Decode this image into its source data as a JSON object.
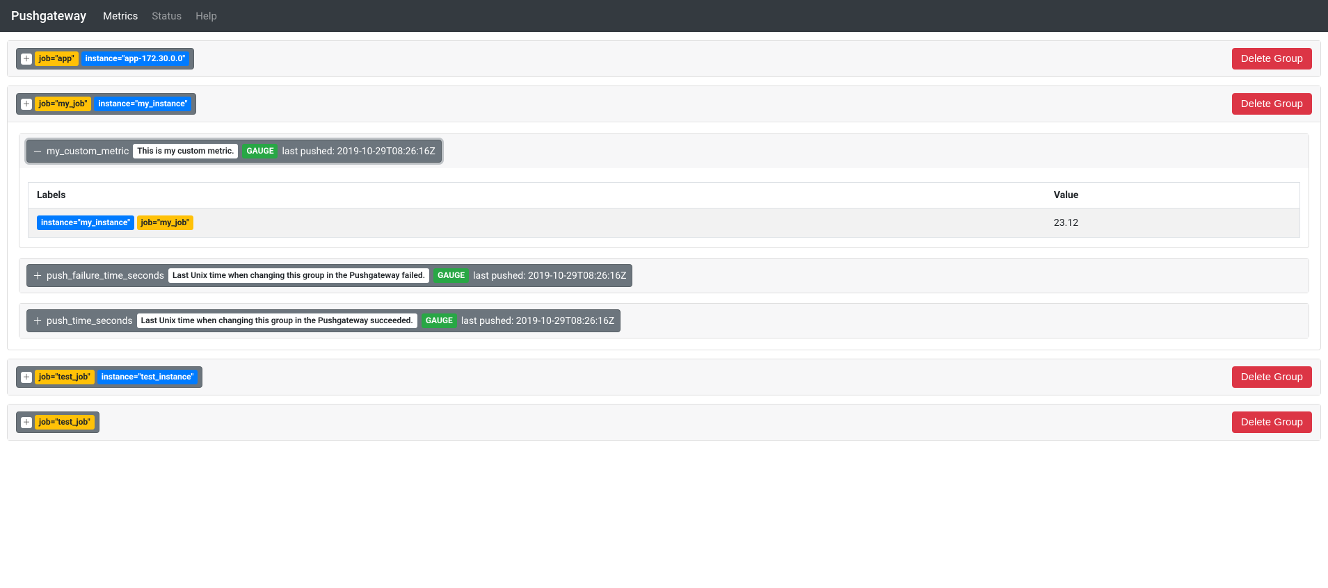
{
  "navbar": {
    "brand": "Pushgateway",
    "items": [
      {
        "label": "Metrics",
        "active": true
      },
      {
        "label": "Status",
        "active": false
      },
      {
        "label": "Help",
        "active": false
      }
    ]
  },
  "delete_label": "Delete Group",
  "groups": [
    {
      "labels": [
        {
          "kind": "job",
          "text": "job=\"app\""
        },
        {
          "kind": "inst",
          "text": "instance=\"app-172.30.0.0\""
        }
      ],
      "expanded": false
    },
    {
      "labels": [
        {
          "kind": "job",
          "text": "job=\"my_job\""
        },
        {
          "kind": "inst",
          "text": "instance=\"my_instance\""
        }
      ],
      "expanded": true,
      "metrics": [
        {
          "name": "my_custom_metric",
          "help": "This is my custom metric.",
          "type": "GAUGE",
          "last_pushed": "last pushed: 2019-10-29T08:26:16Z",
          "expanded": true,
          "table": {
            "headers": [
              "Labels",
              "Value"
            ],
            "rows": [
              {
                "labels": [
                  {
                    "kind": "inst",
                    "text": "instance=\"my_instance\""
                  },
                  {
                    "kind": "job",
                    "text": "job=\"my_job\""
                  }
                ],
                "value": "23.12"
              }
            ]
          }
        },
        {
          "name": "push_failure_time_seconds",
          "help": "Last Unix time when changing this group in the Pushgateway failed.",
          "type": "GAUGE",
          "last_pushed": "last pushed: 2019-10-29T08:26:16Z",
          "expanded": false
        },
        {
          "name": "push_time_seconds",
          "help": "Last Unix time when changing this group in the Pushgateway succeeded.",
          "type": "GAUGE",
          "last_pushed": "last pushed: 2019-10-29T08:26:16Z",
          "expanded": false
        }
      ]
    },
    {
      "labels": [
        {
          "kind": "job",
          "text": "job=\"test_job\""
        },
        {
          "kind": "inst",
          "text": "instance=\"test_instance\""
        }
      ],
      "expanded": false
    },
    {
      "labels": [
        {
          "kind": "job",
          "text": "job=\"test_job\""
        }
      ],
      "expanded": false
    }
  ]
}
